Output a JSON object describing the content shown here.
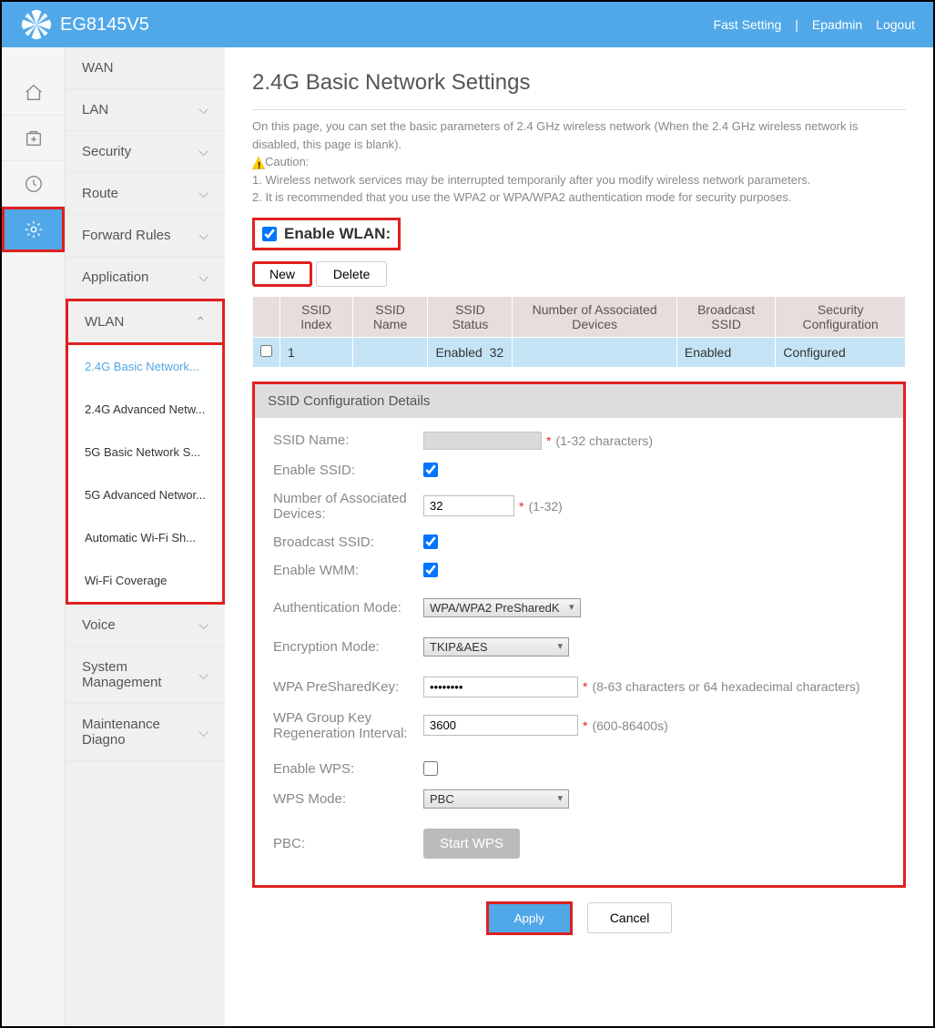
{
  "header": {
    "model": "EG8145V5",
    "links": {
      "fast": "Fast Setting",
      "user": "Epadmin",
      "logout": "Logout"
    }
  },
  "nav": {
    "wan": "WAN",
    "lan": "LAN",
    "security": "Security",
    "route": "Route",
    "forward": "Forward Rules",
    "application": "Application",
    "wlan": "WLAN",
    "voice": "Voice",
    "system": "System Management",
    "maint": "Maintenance Diagno"
  },
  "wlan_sub": {
    "basic24": "2.4G Basic Network...",
    "adv24": "2.4G Advanced Netw...",
    "basic5": "5G Basic Network S...",
    "adv5": "5G Advanced Networ...",
    "auto": "Automatic Wi-Fi Sh...",
    "coverage": "Wi-Fi Coverage"
  },
  "page": {
    "title": "2.4G Basic Network Settings",
    "desc1": "On this page, you can set the basic parameters of 2.4 GHz wireless network (When the 2.4 GHz wireless network is disabled, this page is blank).",
    "caution": "Caution:",
    "desc2": "1. Wireless network services may be interrupted temporarily after you modify wireless network parameters.",
    "desc3": "2. It is recommended that you use the WPA2 or WPA/WPA2 authentication mode for security purposes.",
    "enable_wlan": "Enable WLAN:",
    "new_btn": "New",
    "delete_btn": "Delete"
  },
  "table": {
    "h1": "SSID Index",
    "h2": "SSID Name",
    "h3": "SSID Status",
    "h4": "Number of Associated Devices",
    "h5": "Broadcast SSID",
    "h6": "Security Configuration",
    "r1": {
      "index": "1",
      "name": "",
      "status": "Enabled",
      "devices": "32",
      "broadcast": "Enabled",
      "security": "Configured"
    }
  },
  "config": {
    "title": "SSID Configuration Details",
    "ssid_name": "SSID Name:",
    "ssid_hint": "(1-32 characters)",
    "enable_ssid": "Enable SSID:",
    "num_devices": "Number of Associated Devices:",
    "num_val": "32",
    "num_hint": "(1-32)",
    "broadcast": "Broadcast SSID:",
    "wmm": "Enable WMM:",
    "auth": "Authentication Mode:",
    "auth_val": "WPA/WPA2 PreSharedK",
    "enc": "Encryption Mode:",
    "enc_val": "TKIP&AES",
    "psk": "WPA PreSharedKey:",
    "psk_val": "••••••••",
    "psk_hint": "(8-63 characters or 64 hexadecimal characters)",
    "group": "WPA Group Key Regeneration Interval:",
    "group_val": "3600",
    "group_hint": "(600-86400s)",
    "wps": "Enable WPS:",
    "wps_mode": "WPS Mode:",
    "wps_mode_val": "PBC",
    "pbc": "PBC:",
    "pbc_btn": "Start WPS"
  },
  "bottom": {
    "apply": "Apply",
    "cancel": "Cancel"
  }
}
